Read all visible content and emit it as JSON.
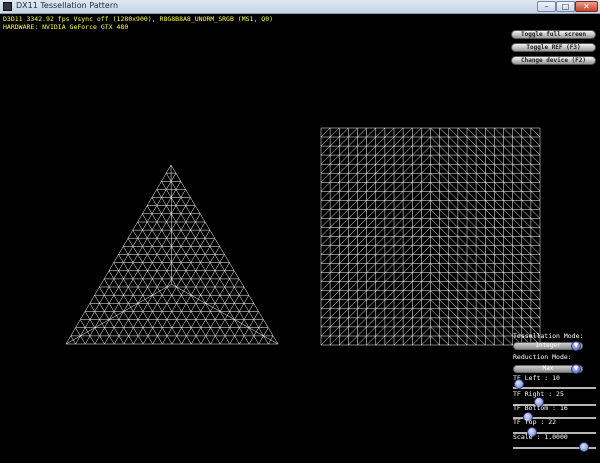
{
  "window": {
    "title": "DX11 Tessellation Pattern",
    "min_glyph": "–",
    "max_glyph": "□",
    "close_glyph": "✕"
  },
  "stats": {
    "line1": "D3D11 3342.92 fps Vsync off (1280x900), R8G8B8A8_UNORM_SRGB (MS1, Q0)",
    "line2": "HARDWARE: NVIDIA GeForce GTX 480"
  },
  "buttons": {
    "toggle_fullscreen": "Toggle full screen",
    "toggle_ref": "Toggle REF (F3)",
    "change_device": "Change device (F2)"
  },
  "controls": {
    "tessellation_mode_label": "Tessellation Mode:",
    "tessellation_mode_value": "Integer",
    "reduction_mode_label": "Reduction Mode:",
    "reduction_mode_value": "Max",
    "tf_left_label": "TF Left : 10",
    "tf_left_value": 10,
    "tf_right_label": "TF Right : 25",
    "tf_right_value": 25,
    "tf_bottom_label": "TF Bottom : 16",
    "tf_bottom_value": 16,
    "tf_top_label": "TF Top : 22",
    "tf_top_value": 22,
    "scale_label": "Scale : 1.0000",
    "scale_value": 1.0
  },
  "colors": {
    "wire": "#ffffff",
    "stats_text": "#ffff3a",
    "background": "#000000"
  }
}
